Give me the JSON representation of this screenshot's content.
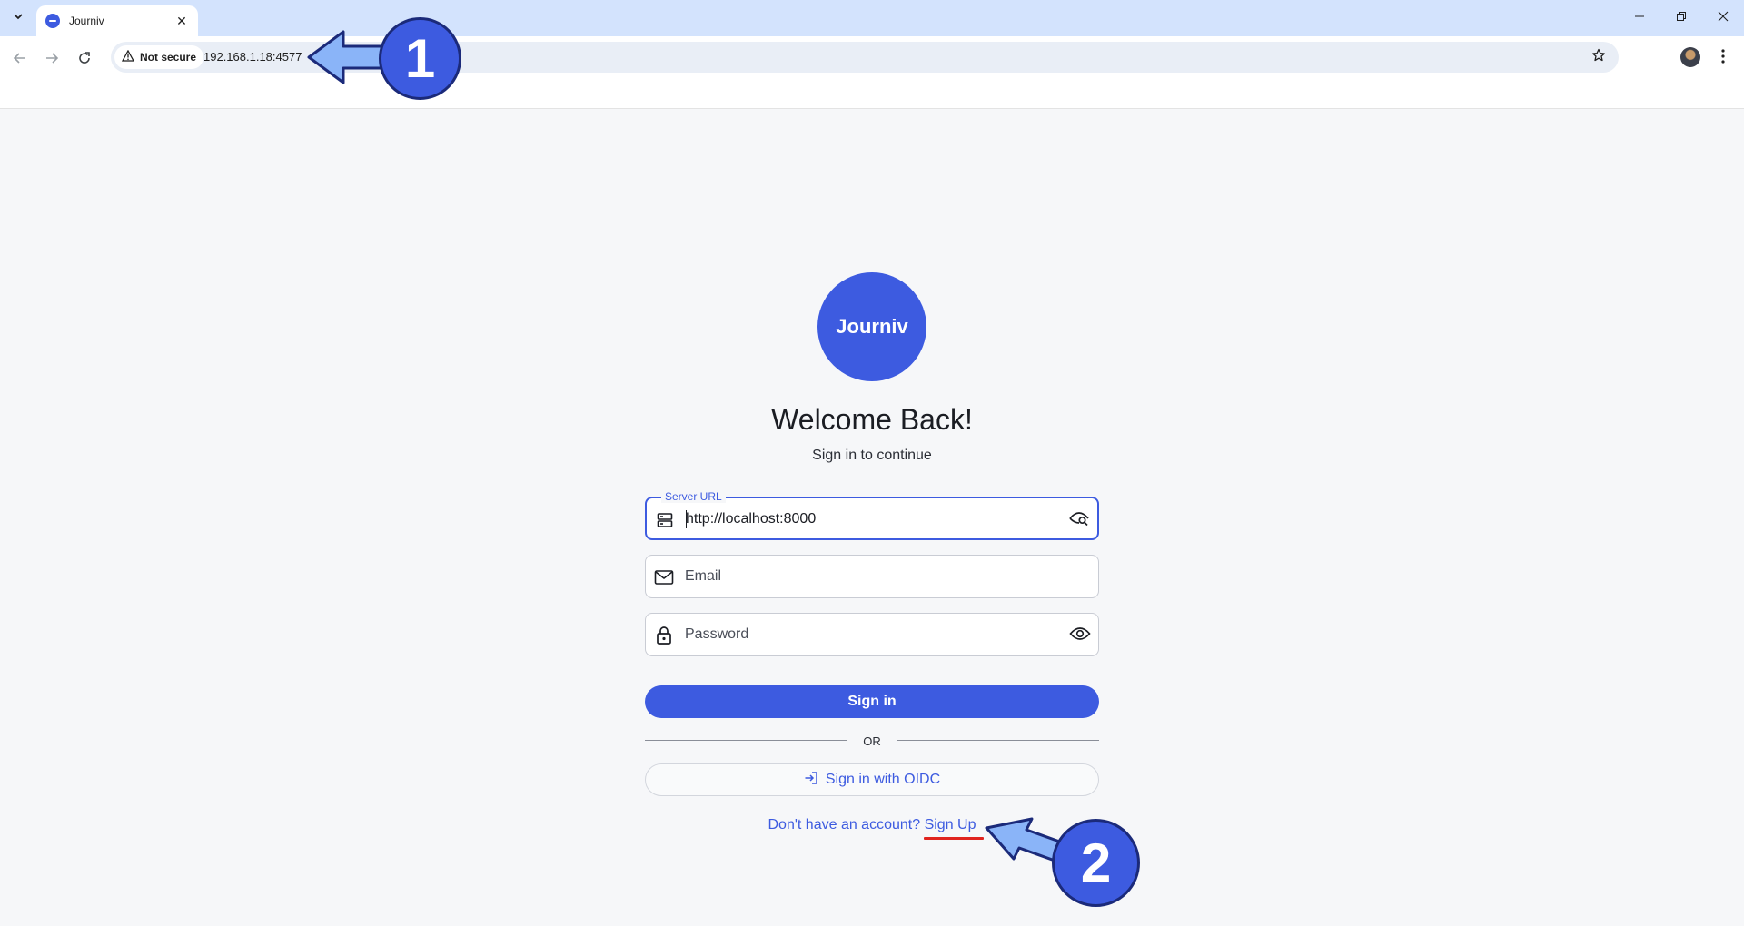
{
  "browser": {
    "tab_title": "Journiv",
    "security_label": "Not secure",
    "url": "192.168.1.18:4577"
  },
  "page": {
    "logo_text": "Journiv",
    "heading": "Welcome Back!",
    "subheading": "Sign in to continue",
    "server_url": {
      "label": "Server URL",
      "value": "http://localhost:8000"
    },
    "email": {
      "placeholder": "Email"
    },
    "password": {
      "placeholder": "Password"
    },
    "signin_label": "Sign in",
    "divider_text": "OR",
    "oidc_label": "Sign in with OIDC",
    "signup_prompt": "Don't have an account?",
    "signup_link": "Sign Up"
  },
  "annotations": {
    "step1": "1",
    "step2": "2"
  },
  "colors": {
    "accent": "#3d5be0",
    "underline": "#e0241f",
    "annotation_arrow": "#8ab4f8"
  }
}
